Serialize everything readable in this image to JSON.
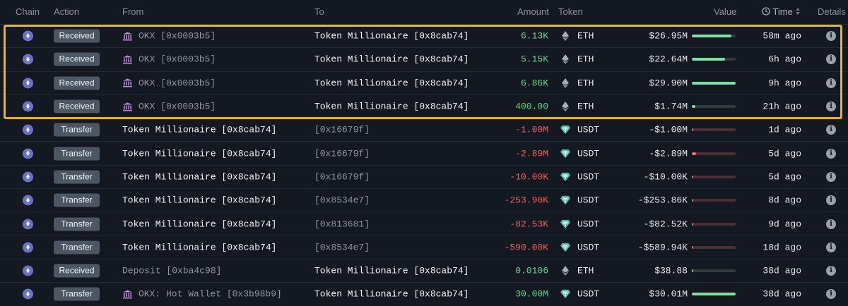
{
  "header": {
    "chain": "Chain",
    "action": "Action",
    "from": "From",
    "to": "To",
    "amount": "Amount",
    "token": "Token",
    "value": "Value",
    "time": "Time",
    "details": "Details"
  },
  "colors": {
    "highlight": "#e7b514",
    "positive": "#6cd18f",
    "negative": "#e86464",
    "eth": "#6c71c4",
    "usdt": "#5bbfa8"
  },
  "rows": [
    {
      "chain": "ethereum-icon",
      "action": "Received",
      "from": "OKX [0x0003b5]",
      "from_icon": "bank-icon",
      "from_dim": true,
      "to": "Token Millionaire [0x8cab74]",
      "to_dim": false,
      "amount": "6.13K",
      "sign": "pos",
      "token_icon": "eth-icon",
      "token": "ETH",
      "value": "$26.95M",
      "bar_fraction": 0.9,
      "time": "58m ago"
    },
    {
      "chain": "ethereum-icon",
      "action": "Received",
      "from": "OKX [0x0003b5]",
      "from_icon": "bank-icon",
      "from_dim": true,
      "to": "Token Millionaire [0x8cab74]",
      "to_dim": false,
      "amount": "5.15K",
      "sign": "pos",
      "token_icon": "eth-icon",
      "token": "ETH",
      "value": "$22.64M",
      "bar_fraction": 0.76,
      "time": "6h ago"
    },
    {
      "chain": "ethereum-icon",
      "action": "Received",
      "from": "OKX [0x0003b5]",
      "from_icon": "bank-icon",
      "from_dim": true,
      "to": "Token Millionaire [0x8cab74]",
      "to_dim": false,
      "amount": "6.86K",
      "sign": "pos",
      "token_icon": "eth-icon",
      "token": "ETH",
      "value": "$29.90M",
      "bar_fraction": 1.0,
      "time": "9h ago"
    },
    {
      "chain": "ethereum-icon",
      "action": "Received",
      "from": "OKX [0x0003b5]",
      "from_icon": "bank-icon",
      "from_dim": true,
      "to": "Token Millionaire [0x8cab74]",
      "to_dim": false,
      "amount": "400.00",
      "sign": "pos",
      "token_icon": "eth-icon",
      "token": "ETH",
      "value": "$1.74M",
      "bar_fraction": 0.08,
      "time": "21h ago"
    },
    {
      "chain": "ethereum-icon",
      "action": "Transfer",
      "from": "Token Millionaire [0x8cab74]",
      "from_icon": "",
      "from_dim": false,
      "to": "[0x16679f]",
      "to_dim": true,
      "amount": "-1.00M",
      "sign": "neg",
      "token_icon": "usdt-icon",
      "token": "USDT",
      "value": "-$1.00M",
      "bar_fraction": 0.04,
      "time": "1d ago"
    },
    {
      "chain": "ethereum-icon",
      "action": "Transfer",
      "from": "Token Millionaire [0x8cab74]",
      "from_icon": "",
      "from_dim": false,
      "to": "[0x16679f]",
      "to_dim": true,
      "amount": "-2.89M",
      "sign": "neg",
      "token_icon": "usdt-icon",
      "token": "USDT",
      "value": "-$2.89M",
      "bar_fraction": 0.1,
      "time": "5d ago"
    },
    {
      "chain": "ethereum-icon",
      "action": "Transfer",
      "from": "Token Millionaire [0x8cab74]",
      "from_icon": "",
      "from_dim": false,
      "to": "[0x16679f]",
      "to_dim": true,
      "amount": "-10.00K",
      "sign": "neg",
      "token_icon": "usdt-icon",
      "token": "USDT",
      "value": "-$10.00K",
      "bar_fraction": 0.01,
      "time": "5d ago"
    },
    {
      "chain": "ethereum-icon",
      "action": "Transfer",
      "from": "Token Millionaire [0x8cab74]",
      "from_icon": "",
      "from_dim": false,
      "to": "[0x8534e7]",
      "to_dim": true,
      "amount": "-253.90K",
      "sign": "neg",
      "token_icon": "usdt-icon",
      "token": "USDT",
      "value": "-$253.86K",
      "bar_fraction": 0.02,
      "time": "8d ago"
    },
    {
      "chain": "ethereum-icon",
      "action": "Transfer",
      "from": "Token Millionaire [0x8cab74]",
      "from_icon": "",
      "from_dim": false,
      "to": "[0x813681]",
      "to_dim": true,
      "amount": "-82.53K",
      "sign": "neg",
      "token_icon": "usdt-icon",
      "token": "USDT",
      "value": "-$82.52K",
      "bar_fraction": 0.01,
      "time": "9d ago"
    },
    {
      "chain": "ethereum-icon",
      "action": "Transfer",
      "from": "Token Millionaire [0x8cab74]",
      "from_icon": "",
      "from_dim": false,
      "to": "[0x8534e7]",
      "to_dim": true,
      "amount": "-590.00K",
      "sign": "neg",
      "token_icon": "usdt-icon",
      "token": "USDT",
      "value": "-$589.94K",
      "bar_fraction": 0.02,
      "time": "18d ago"
    },
    {
      "chain": "ethereum-icon",
      "action": "Received",
      "from": "Deposit [0xba4c98]",
      "from_icon": "",
      "from_dim": true,
      "to": "Token Millionaire [0x8cab74]",
      "to_dim": false,
      "amount": "0.0106",
      "sign": "pos",
      "token_icon": "eth-icon",
      "token": "ETH",
      "value": "$38.88",
      "bar_fraction": 0.0,
      "time": "38d ago"
    },
    {
      "chain": "ethereum-icon",
      "action": "Transfer",
      "from": "OKX: Hot Wallet [0x3b98b9]",
      "from_icon": "bank-icon",
      "from_dim": true,
      "to": "Token Millionaire [0x8cab74]",
      "to_dim": false,
      "amount": "30.00M",
      "sign": "pos",
      "token_icon": "usdt-icon",
      "token": "USDT",
      "value": "$30.01M",
      "bar_fraction": 1.0,
      "time": "38d ago"
    }
  ]
}
